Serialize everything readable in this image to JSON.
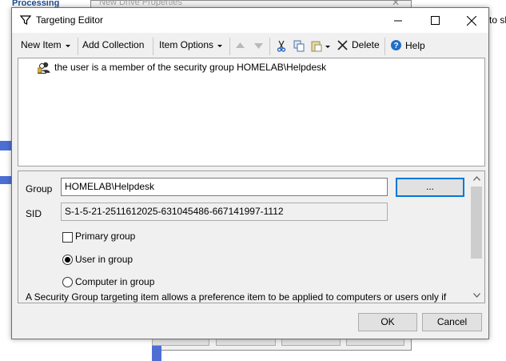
{
  "background": {
    "left_window_heading": "Processing",
    "drive_window_title": "New Drive Properties",
    "right_edge_text": "to sh"
  },
  "dialog": {
    "title": "Targeting Editor"
  },
  "toolbar": {
    "new_item": "New Item",
    "add_collection": "Add Collection",
    "item_options": "Item Options",
    "delete": "Delete",
    "help": "Help"
  },
  "tree": {
    "items": [
      {
        "label": "the user is a member of the security group HOMELAB\\Helpdesk",
        "icon": "security-group-icon"
      }
    ]
  },
  "properties": {
    "group_label": "Group",
    "group_value": "HOMELAB\\Helpdesk",
    "browse_label": "...",
    "sid_label": "SID",
    "sid_value": "S-1-5-21-2511612025-631045486-667141997-1112",
    "primary_group_label": "Primary group",
    "primary_group_checked": false,
    "user_in_group_label": "User in group",
    "computer_in_group_label": "Computer in group",
    "selected_option": "User in group",
    "description": "A Security Group targeting item allows a preference item to be applied to computers or users only if"
  },
  "footer": {
    "ok": "OK",
    "cancel": "Cancel"
  },
  "colors": {
    "focus_border": "#0078d7",
    "help_icon": "#1f6fc5",
    "background_accent": "#4d6fd4"
  }
}
